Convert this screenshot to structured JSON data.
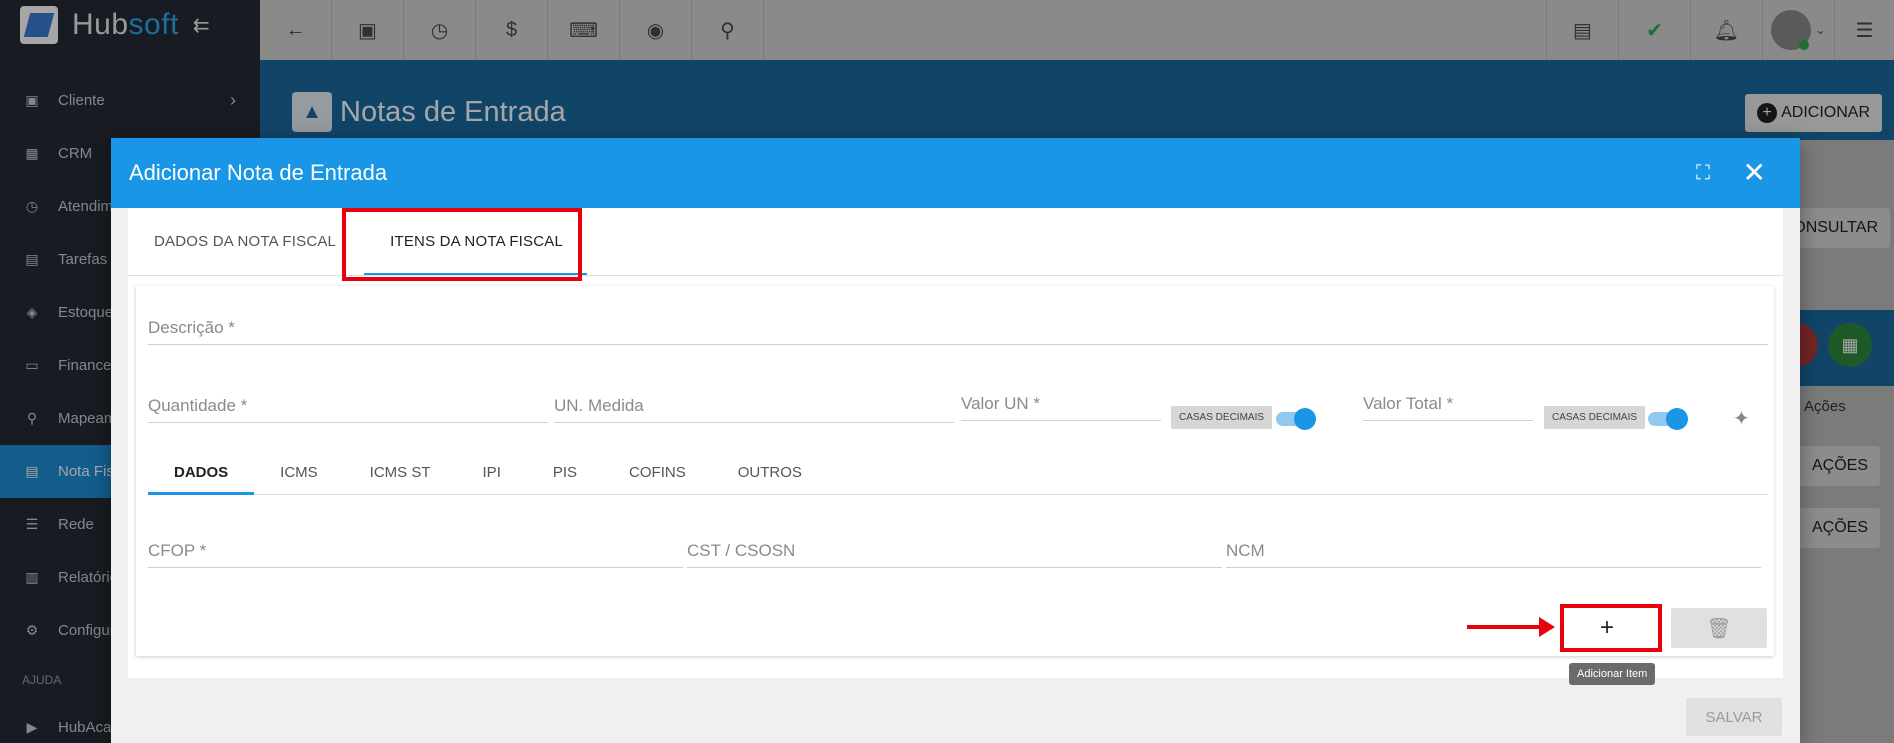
{
  "brand": {
    "name_main": "Hub",
    "name_accent": "soft"
  },
  "sidebar": {
    "items": [
      {
        "label": "Cliente",
        "icon": "id-card-icon"
      },
      {
        "label": "CRM",
        "icon": "board-icon"
      },
      {
        "label": "Atendim",
        "icon": "calendar-clock-icon"
      },
      {
        "label": "Tarefas",
        "icon": "tasks-icon"
      },
      {
        "label": "Estoque",
        "icon": "box-icon"
      },
      {
        "label": "Financei",
        "icon": "money-icon"
      },
      {
        "label": "Mapeam",
        "icon": "map-pin-icon"
      },
      {
        "label": "Nota Fis",
        "icon": "document-icon"
      },
      {
        "label": "Rede",
        "icon": "server-icon"
      },
      {
        "label": "Relatóric",
        "icon": "report-icon"
      },
      {
        "label": "Configur",
        "icon": "gear-icon"
      }
    ],
    "section_label": "AJUDA",
    "help_item": "HubAcad"
  },
  "page": {
    "title": "Notas de Entrada",
    "add_button": "ADICIONAR",
    "bg_consultar": "CONSULTAR",
    "bg_acoes_label": "Ações",
    "bg_acoes_btn1": "AÇÕES",
    "bg_acoes_btn2": "AÇÕES"
  },
  "modal": {
    "title": "Adicionar Nota de Entrada",
    "tabs": [
      "DADOS DA NOTA FISCAL",
      "ITENS DA NOTA FISCAL"
    ],
    "fields": {
      "descricao": "Descrição *",
      "quantidade": "Quantidade *",
      "un_medida": "UN. Medida",
      "valor_un": "Valor UN *",
      "casas_decimais_1": "CASAS DECIMAIS",
      "valor_total": "Valor Total *",
      "casas_decimais_2": "CASAS DECIMAIS",
      "cfop": "CFOP *",
      "cst": "CST / CSOSN",
      "ncm": "NCM"
    },
    "subtabs": [
      "DADOS",
      "ICMS",
      "ICMS ST",
      "IPI",
      "PIS",
      "COFINS",
      "OUTROS"
    ],
    "add_item_label": "+",
    "tooltip": "Adicionar Item",
    "save_button": "SALVAR"
  }
}
